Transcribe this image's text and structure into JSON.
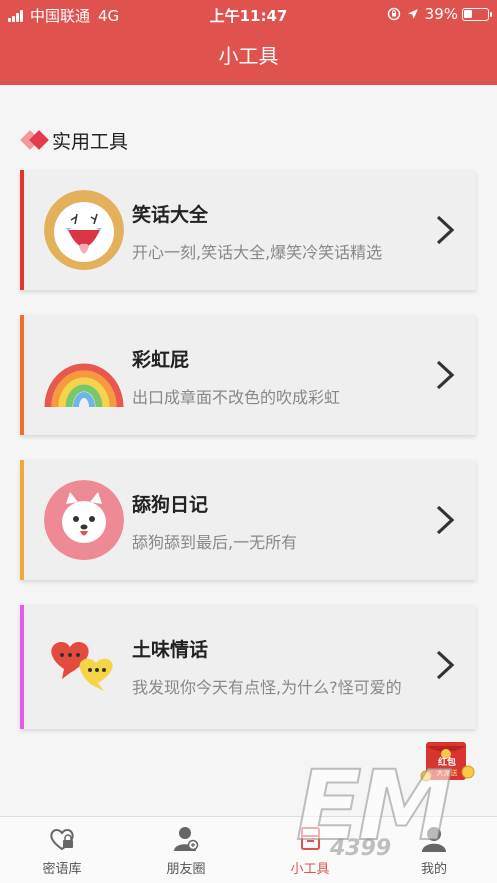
{
  "status_bar": {
    "carrier": "中国联通",
    "network": "4G",
    "time": "上午11:47",
    "battery": "39%",
    "battery_level": 0.39
  },
  "header": {
    "title": "小工具"
  },
  "section": {
    "title": "实用工具"
  },
  "tools": [
    {
      "title": "笑话大全",
      "desc": "开心一刻,笑话大全,爆笑冷笑话精选",
      "accent": "#e0362c",
      "icon": "laughing-face-icon"
    },
    {
      "title": "彩虹屁",
      "desc": "出口成章面不改色的吹成彩虹",
      "accent": "#e8732e",
      "icon": "rainbow-icon"
    },
    {
      "title": "舔狗日记",
      "desc": "舔狗舔到最后,一无所有",
      "accent": "#f2a93b",
      "icon": "dog-icon"
    },
    {
      "title": "土味情话",
      "desc": "我发现你今天有点怪,为什么?怪可爱的",
      "accent": "#e45be8",
      "icon": "heart-chat-icon"
    }
  ],
  "tabbar": {
    "items": [
      {
        "label": "密语库",
        "icon": "heart-lock-icon"
      },
      {
        "label": "朋友圈",
        "icon": "friends-icon"
      },
      {
        "label": "小工具",
        "icon": "toolbox-icon"
      },
      {
        "label": "我的",
        "icon": "user-icon"
      }
    ],
    "active_color": "#e0524e"
  },
  "promo": {
    "line1": "红包",
    "line2": "大派送"
  },
  "watermark": {
    "big": "EM",
    "small": "4399"
  },
  "colors": {
    "header": "#e0524e",
    "background": "#f5f5f5"
  }
}
